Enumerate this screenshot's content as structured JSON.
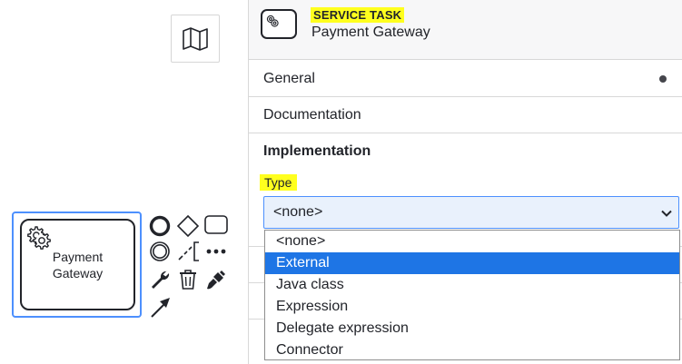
{
  "canvas": {
    "task_label_lines": [
      "Payment",
      "Gateway"
    ],
    "icons": {
      "minimap": "map-icon",
      "task_type": "gear-icon",
      "append_end_event": "end-event-icon",
      "append_gateway": "gateway-icon",
      "append_task": "task-icon",
      "append_intermediate_event": "intermediate-event-icon",
      "append_text_annotation": "text-annotation-icon",
      "more_options": "more-options-icon",
      "change_type": "wrench-icon",
      "delete": "trash-icon",
      "set_color": "paintbrush-icon",
      "connect": "arrow-connect-icon"
    }
  },
  "panel": {
    "header": {
      "type_label": "SERVICE TASK",
      "element_name": "Payment Gateway"
    },
    "groups": [
      {
        "label": "General",
        "has_indicator": true
      },
      {
        "label": "Documentation",
        "has_indicator": false
      }
    ],
    "implementation": {
      "title": "Implementation",
      "type_label": "Type",
      "selected_value": "<none>",
      "options": [
        "<none>",
        "External",
        "Java class",
        "Expression",
        "Delegate expression",
        "Connector"
      ],
      "highlighted_option": "External"
    }
  },
  "colors": {
    "selection": "#4d90fe",
    "highlight_marker": "#ffff1e",
    "option_highlight": "#1e75e5",
    "select_background": "#e9f1fc"
  }
}
